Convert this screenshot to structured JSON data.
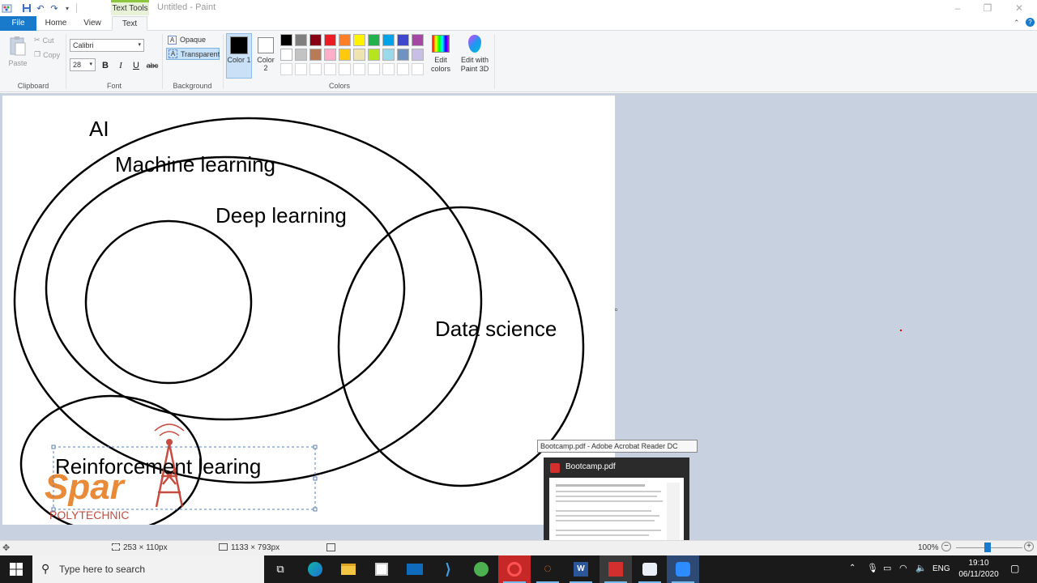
{
  "window": {
    "title": "Untitled - Paint",
    "context_tab": "Text Tools"
  },
  "tabs": [
    "File",
    "Home",
    "View",
    "Text"
  ],
  "clipboard": {
    "paste": "Paste",
    "cut": "Cut",
    "copy": "Copy",
    "label": "Clipboard"
  },
  "font": {
    "family": "Calibri",
    "size": "28",
    "bold": "B",
    "italic": "I",
    "underline": "U",
    "strike": "abc",
    "label": "Font"
  },
  "background": {
    "opaque": "Opaque",
    "transparent": "Transparent",
    "label": "Background"
  },
  "colors": {
    "color1": "Color 1",
    "color2": "Color 2",
    "edit_colors": "Edit colors",
    "edit_paint3d": "Edit with Paint 3D",
    "label": "Colors",
    "color1_value": "#000000",
    "color2_value": "#ffffff",
    "palette": [
      "#000000",
      "#7f7f7f",
      "#880015",
      "#ed1c24",
      "#ff7f27",
      "#fff200",
      "#22b14c",
      "#00a2e8",
      "#3f48cc",
      "#a349a4",
      "#ffffff",
      "#c3c3c3",
      "#b97a57",
      "#ffaec9",
      "#ffc90e",
      "#efe4b0",
      "#b5e61d",
      "#99d9ea",
      "#7092be",
      "#c8bfe7"
    ]
  },
  "canvas": {
    "labels": {
      "ai": "AI",
      "ml": "Machine learning",
      "dl": "Deep learning",
      "ds": "Data science",
      "rl": "Reinforcement learing"
    },
    "logo_text": "Spark",
    "logo_sub": "POLYTECHNIC"
  },
  "status": {
    "selection_size": "253 × 110px",
    "canvas_size": "1133 × 793px",
    "zoom": "100%"
  },
  "taskbar": {
    "search_placeholder": "Type here to search",
    "lang": "ENG",
    "time": "19:10",
    "date": "06/11/2020",
    "tooltip": "Bootcamp.pdf - Adobe Acrobat Reader DC",
    "preview_title": "Bootcamp.pdf"
  }
}
